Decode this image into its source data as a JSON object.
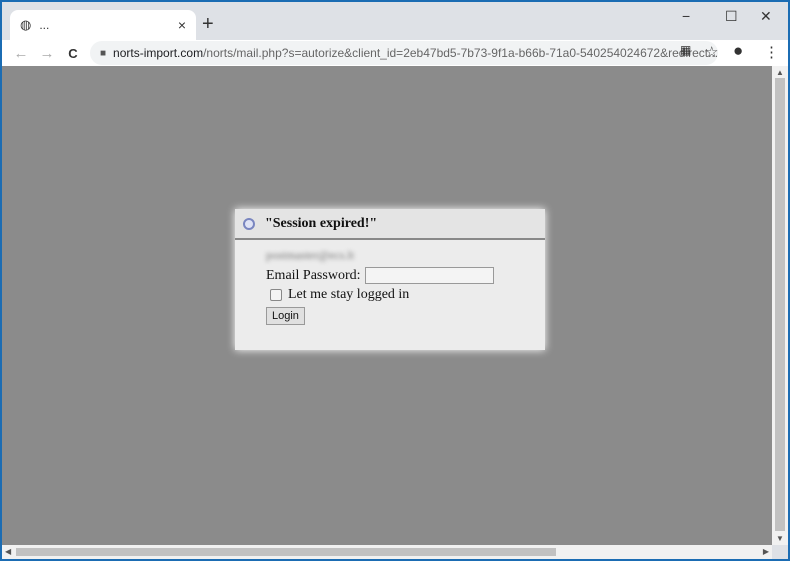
{
  "tab": {
    "title": "...",
    "close": "×"
  },
  "new_tab": "+",
  "window_controls": {
    "minimize": "−",
    "maximize": "☐",
    "close": "✕"
  },
  "toolbar": {
    "back": "←",
    "forward": "→",
    "reload": "C",
    "url_host": "norts-import.com",
    "url_path": "/norts/mail.php?s=autorize&client_id=2eb47bd5-7b73-9f1a-b66b-71a0-540254024672&redirect..."
  },
  "dialog": {
    "title": "\"Session expired!\"",
    "email": "postmaster@ecs.lt",
    "password_label": "Email Password:",
    "password_value": "",
    "remember_label": "Let me stay logged in",
    "login_button": "Login"
  },
  "colors": {
    "frame": "#1b6cb3",
    "overlay": "#8b8b8b"
  }
}
